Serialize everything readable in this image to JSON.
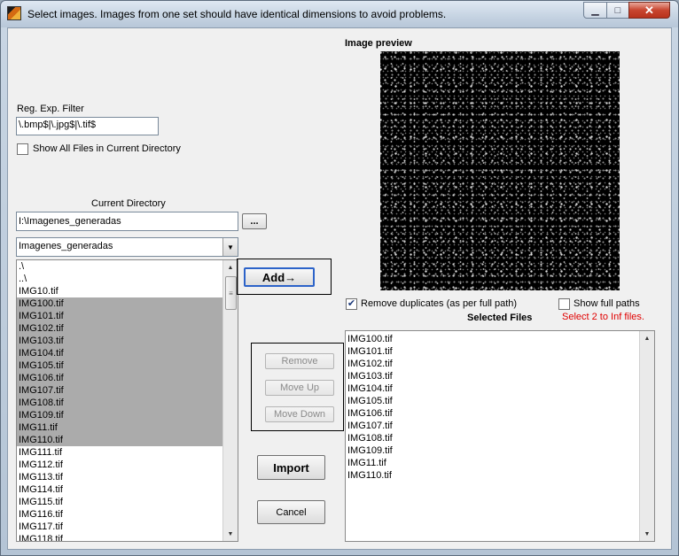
{
  "window": {
    "title": "Select images. Images from one set should have identical dimensions to avoid problems.",
    "minimize_glyph": "▁",
    "maximize_glyph": "□",
    "close_glyph": "✕"
  },
  "filter": {
    "label": "Reg. Exp. Filter",
    "value": "\\.bmp$|\\.jpg$|\\.tif$",
    "show_all_label": "Show All Files in Current Directory",
    "show_all_checked": false
  },
  "directory": {
    "label": "Current Directory",
    "path": "I:\\Imagenes_generadas",
    "browse_label": "...",
    "dropdown_value": "Imagenes_generadas"
  },
  "file_list": {
    "items": [
      {
        "name": ".\\",
        "selected": false
      },
      {
        "name": "..\\",
        "selected": false
      },
      {
        "name": "IMG10.tif",
        "selected": false
      },
      {
        "name": "IMG100.tif",
        "selected": true
      },
      {
        "name": "IMG101.tif",
        "selected": true
      },
      {
        "name": "IMG102.tif",
        "selected": true
      },
      {
        "name": "IMG103.tif",
        "selected": true
      },
      {
        "name": "IMG104.tif",
        "selected": true
      },
      {
        "name": "IMG105.tif",
        "selected": true
      },
      {
        "name": "IMG106.tif",
        "selected": true
      },
      {
        "name": "IMG107.tif",
        "selected": true
      },
      {
        "name": "IMG108.tif",
        "selected": true
      },
      {
        "name": "IMG109.tif",
        "selected": true
      },
      {
        "name": "IMG11.tif",
        "selected": true
      },
      {
        "name": "IMG110.tif",
        "selected": true
      },
      {
        "name": "IMG111.tif",
        "selected": false
      },
      {
        "name": "IMG112.tif",
        "selected": false
      },
      {
        "name": "IMG113.tif",
        "selected": false
      },
      {
        "name": "IMG114.tif",
        "selected": false
      },
      {
        "name": "IMG115.tif",
        "selected": false
      },
      {
        "name": "IMG116.tif",
        "selected": false
      },
      {
        "name": "IMG117.tif",
        "selected": false
      },
      {
        "name": "IMG118.tif",
        "selected": false
      }
    ]
  },
  "buttons": {
    "add": "Add→",
    "remove": "Remove",
    "move_up": "Move Up",
    "move_down": "Move Down",
    "import": "Import",
    "cancel": "Cancel"
  },
  "preview": {
    "label": "Image preview"
  },
  "options": {
    "remove_duplicates_label": "Remove duplicates (as per full path)",
    "remove_duplicates_checked": true,
    "show_full_paths_label": "Show full paths",
    "show_full_paths_checked": false
  },
  "selected_files": {
    "label": "Selected Files",
    "hint": "Select 2 to Inf files.",
    "hint_color": "#e00000",
    "items": [
      "IMG100.tif",
      "IMG101.tif",
      "IMG102.tif",
      "IMG103.tif",
      "IMG104.tif",
      "IMG105.tif",
      "IMG106.tif",
      "IMG107.tif",
      "IMG108.tif",
      "IMG109.tif",
      "IMG11.tif",
      "IMG110.tif"
    ]
  },
  "icons": {
    "checkmark": "✔",
    "scroll_up": "▲",
    "scroll_down": "▼",
    "dropdown": "▼",
    "grip": "≡"
  }
}
